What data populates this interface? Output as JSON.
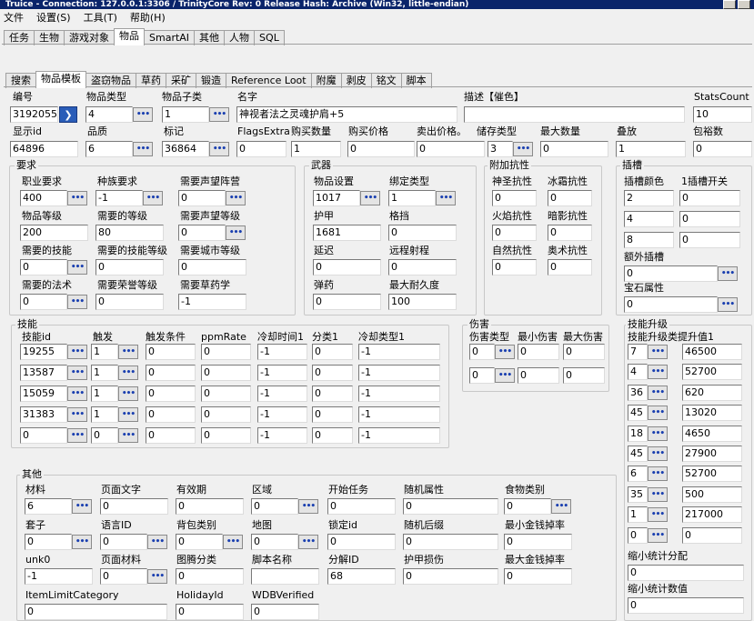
{
  "window": {
    "title": "Truice - Connection: 127.0.0.1:3306 / TrinityCore Rev: 0 Release Hash: Archive (Win32, little-endian)"
  },
  "menu": [
    "文件",
    "设置(S)",
    "工具(T)",
    "帮助(H)"
  ],
  "main_tabs": [
    "任务",
    "生物",
    "游戏对象",
    "物品",
    "SmartAI",
    "其他",
    "人物",
    "SQL"
  ],
  "sub_tabs": [
    "搜索",
    "物品模板",
    "盗窃物品",
    "草药",
    "采矿",
    "锻造",
    "Reference Loot",
    "附魔",
    "剥皮",
    "铭文",
    "脚本"
  ],
  "top": {
    "entry_label": "编号",
    "entry": "3192055",
    "class_label": "物品类型",
    "class": "4",
    "subclass_label": "物品子类",
    "subclass": "1",
    "name_label": "名字",
    "name": "神视者法之灵魂护肩+5",
    "desc_label": "描述【催色】",
    "desc": "",
    "statscount_label": "StatsCount",
    "statscount": "10",
    "displayid_label": "显示id",
    "displayid": "64896",
    "quality_label": "品质",
    "quality": "6",
    "flags_label": "标记",
    "flags": "36864",
    "flagsextra_label": "FlagsExtra",
    "flagsextra": "0",
    "buycount_label": "购买数量",
    "buycount": "1",
    "buyprice_label": "购买价格",
    "buyprice": "0",
    "sellprice_label": "卖出价格。",
    "sellprice": "0",
    "inventorytype_label": "储存类型",
    "inventorytype": "3",
    "maxcount_label": "最大数量",
    "maxcount": "0",
    "stackable_label": "叠放",
    "stackable": "1",
    "containerslots_label": "包裕数",
    "containerslots": "0"
  },
  "req": {
    "title": "要求",
    "class_label": "职业要求",
    "class": "400",
    "race_label": "种族要求",
    "race": "-1",
    "reqfaction_label": "需要声望阵营",
    "reqfaction": "0",
    "itemlevel_label": "物品等级",
    "itemlevel": "200",
    "reqlevel_label": "需要的等级",
    "reqlevel": "80",
    "reqrep_label": "需要声望等级",
    "reqrep": "0",
    "reqskill_label": "需要的技能",
    "reqskill": "0",
    "reqskillrank_label": "需要的技能等级",
    "reqskillrank": "0",
    "reqcity_label": "需要城市等级",
    "reqcity": "0",
    "reqspell_label": "需要的法术",
    "reqspell": "0",
    "reqhonor_label": "需要荣誉等级",
    "reqhonor": "0",
    "reqherb_label": "需要草药学",
    "reqherb": "-1"
  },
  "weapon": {
    "title": "武器",
    "itemset_label": "物品设置",
    "itemset": "1017",
    "bonding_label": "绑定类型",
    "bonding": "1",
    "armor_label": "护甲",
    "armor": "1681",
    "block_label": "格挡",
    "block": "0",
    "delay_label": "延迟",
    "delay": "0",
    "range_label": "远程射程",
    "range": "0",
    "ammo_label": "弹药",
    "ammo": "0",
    "durability_label": "最大耐久度",
    "durability": "100"
  },
  "resist": {
    "title": "附加抗性",
    "holy_label": "神圣抗性",
    "holy": "0",
    "frost_label": "冰霜抗性",
    "frost": "0",
    "fire_label": "火焰抗性",
    "fire": "0",
    "shadow_label": "暗影抗性",
    "shadow": "0",
    "nature_label": "自然抗性",
    "nature": "0",
    "arcane_label": "奥术抗性",
    "arcane": "0"
  },
  "socket": {
    "title": "插槽",
    "color_label": "插槽颜色",
    "open_label": "1插槽开关",
    "c1": "2",
    "o1": "0",
    "c2": "4",
    "o2": "0",
    "c3": "8",
    "o3": "0",
    "bonus_label": "额外插槽",
    "bonus": "0",
    "gemprop_label": "宝石属性",
    "gemprop": "0"
  },
  "spells": {
    "title": "技能",
    "headers": [
      "技能id",
      "触发",
      "触发条件",
      "ppmRate",
      "冷却时间1",
      "分类1",
      "冷却类型1"
    ],
    "rows": [
      [
        "19255",
        "1",
        "0",
        "0",
        "-1",
        "0",
        "-1"
      ],
      [
        "13587",
        "1",
        "0",
        "0",
        "-1",
        "0",
        "-1"
      ],
      [
        "15059",
        "1",
        "0",
        "0",
        "-1",
        "0",
        "-1"
      ],
      [
        "31383",
        "1",
        "0",
        "0",
        "-1",
        "0",
        "-1"
      ],
      [
        "0",
        "0",
        "0",
        "0",
        "-1",
        "0",
        "-1"
      ]
    ]
  },
  "damage": {
    "title": "伤害",
    "headers": [
      "伤害类型",
      "最小伤害",
      "最大伤害"
    ],
    "rows": [
      [
        "0",
        "0",
        "0"
      ],
      [
        "0",
        "0",
        "0"
      ]
    ]
  },
  "statup": {
    "title": "技能升级",
    "header": "技能升级类提升值1",
    "rows": [
      [
        "7",
        "46500"
      ],
      [
        "4",
        "52700"
      ],
      [
        "36",
        "620"
      ],
      [
        "45",
        "13020"
      ],
      [
        "18",
        "4650"
      ],
      [
        "45",
        "27900"
      ],
      [
        "6",
        "52700"
      ],
      [
        "35",
        "500"
      ],
      [
        "1",
        "217000"
      ],
      [
        "0",
        "0"
      ]
    ],
    "scaledist_label": "缩小统计分配",
    "scaledist": "0",
    "scaleval_label": "缩小统计数值",
    "scaleval": "0"
  },
  "other": {
    "title": "其他",
    "material_label": "材料",
    "material": "6",
    "pagetext_label": "页面文字",
    "pagetext": "0",
    "duration_label": "有效期",
    "duration": "0",
    "area_label": "区域",
    "area": "0",
    "startquest_label": "开始任务",
    "startquest": "0",
    "randomprop_label": "随机属性",
    "randomprop": "0",
    "foodtype_label": "食物类别",
    "foodtype": "0",
    "sheath_label": "套子",
    "sheath": "0",
    "language_label": "语言ID",
    "language": "0",
    "bagfamily_label": "背包类别",
    "bagfamily": "0",
    "map_label": "地图",
    "map": "0",
    "lockid_label": "锁定id",
    "lockid": "0",
    "randomsuffix_label": "随机后缀",
    "randomsuffix": "0",
    "minmoney_label": "最小金钱掉率",
    "minmoney": "0",
    "unk0_label": "unk0",
    "unk0": "-1",
    "pagematerial_label": "页面材料",
    "pagematerial": "0",
    "totem_label": "图腾分类",
    "totem": "0",
    "script_label": "脚本名称",
    "script": "",
    "disenchant_label": "分解ID",
    "disenchant": "68",
    "armordmg_label": "护甲损伤",
    "armordmg": "0",
    "maxmoney_label": "最大金钱掉率",
    "maxmoney": "0",
    "limitcat_label": "ItemLimitCategory",
    "limitcat": "0",
    "holiday_label": "HolidayId",
    "holiday": "0",
    "wdb_label": "WDBVerified",
    "wdb": "0"
  },
  "lookup_glyph": "•••",
  "arrow_glyph": "❯"
}
